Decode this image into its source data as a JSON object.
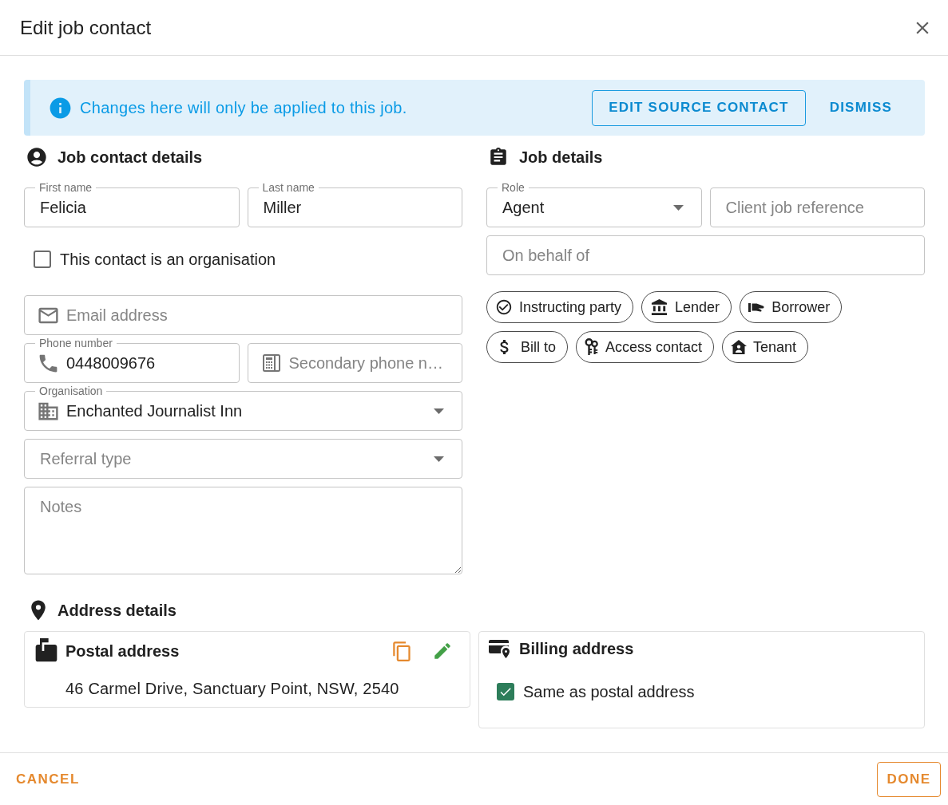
{
  "dialog": {
    "title": "Edit job contact"
  },
  "notice": {
    "message": "Changes here will only be applied to this job.",
    "actions": [
      {
        "kind": "outlined",
        "label": "EDIT SOURCE CONTACT"
      },
      {
        "kind": "text",
        "label": "DISMISS"
      }
    ]
  },
  "contact_details": {
    "heading": "Job contact details",
    "first_name": {
      "label": "First name",
      "value": "Felicia"
    },
    "last_name": {
      "label": "Last name",
      "value": "Miller"
    },
    "is_organisation": {
      "label": "This contact is an organisation",
      "checked": false
    },
    "email": {
      "placeholder": "Email address"
    },
    "phone": {
      "label": "Phone number",
      "value": "0448009676"
    },
    "secondary_phone": {
      "placeholder": "Secondary phone n…"
    },
    "organisation": {
      "label": "Organisation",
      "value": "Enchanted Journalist Inn"
    },
    "referral_type": {
      "placeholder": "Referral type"
    },
    "notes": {
      "placeholder": "Notes"
    }
  },
  "job_details": {
    "heading": "Job details",
    "role": {
      "label": "Role",
      "value": "Agent"
    },
    "client_job_reference": {
      "placeholder": "Client job reference"
    },
    "on_behalf_of": {
      "placeholder": "On behalf of"
    },
    "tags": [
      {
        "kind": "instructing",
        "label": "Instructing party",
        "selected": false
      },
      {
        "kind": "lender",
        "label": "Lender",
        "selected": false
      },
      {
        "kind": "borrower",
        "label": "Borrower",
        "selected": false
      },
      {
        "kind": "bill_to",
        "label": "Bill to",
        "selected": false
      },
      {
        "kind": "access",
        "label": "Access contact",
        "selected": false
      },
      {
        "kind": "tenant",
        "label": "Tenant",
        "selected": false
      }
    ]
  },
  "address_details": {
    "heading": "Address details",
    "postal": {
      "title": "Postal address",
      "address": "46 Carmel Drive, Sanctuary Point, NSW, 2540"
    },
    "billing": {
      "title": "Billing address",
      "same_as_postal": {
        "label": "Same as postal address",
        "checked": true
      }
    }
  },
  "footer": {
    "cancel": "CANCEL",
    "done": "DONE"
  }
}
